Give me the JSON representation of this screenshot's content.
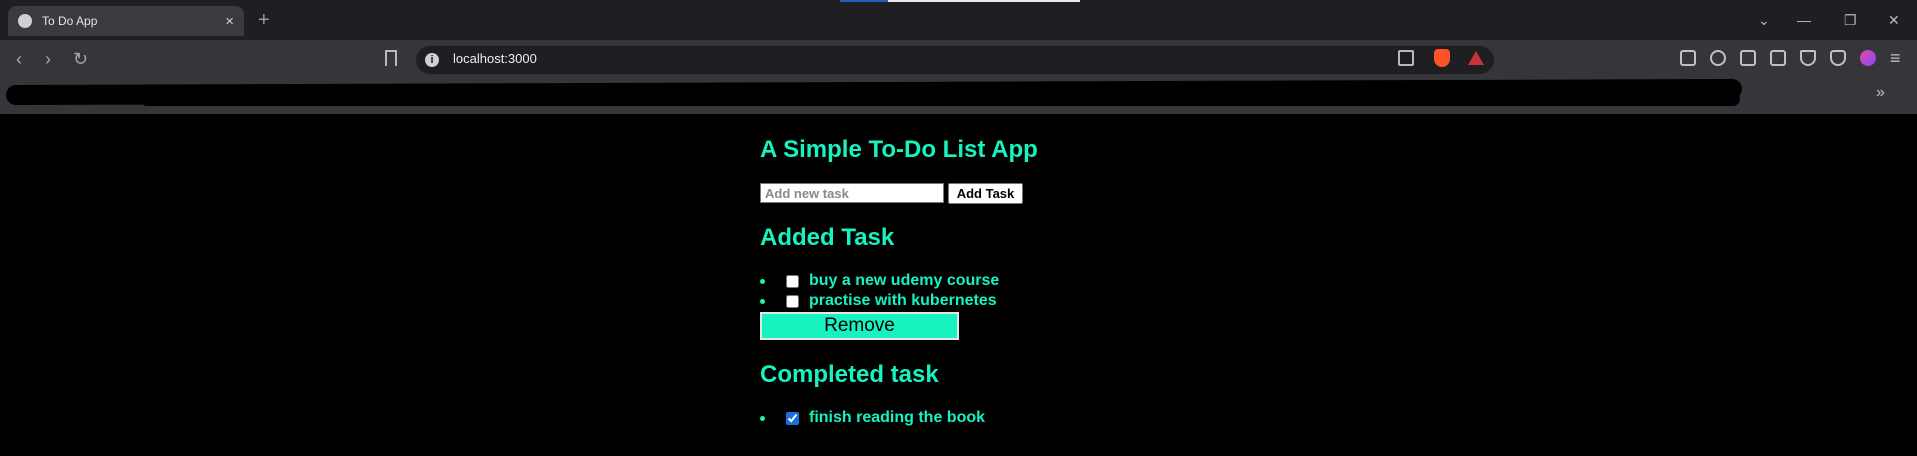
{
  "browser": {
    "tab_title": "To Do App",
    "tab_close": "×",
    "new_tab": "+",
    "url": "localhost:3000",
    "info_glyph": "i",
    "back_glyph": "‹",
    "forward_glyph": "›",
    "reload_glyph": "↻",
    "minimize_glyph": "—",
    "restore_glyph": "❐",
    "close_glyph": "✕",
    "tab_list_glyph": "⌄",
    "menu_glyph": "≡",
    "more_bookmarks_glyph": "»"
  },
  "app": {
    "title": "A Simple To-Do List App",
    "input_placeholder": "Add new task",
    "add_button_label": "Add Task",
    "added_heading": "Added Task",
    "added_tasks": [
      {
        "text": "buy a new udemy course",
        "checked": false
      },
      {
        "text": "practise with kubernetes",
        "checked": false
      }
    ],
    "remove_button_label": "Remove",
    "completed_heading": "Completed task",
    "completed_tasks": [
      {
        "text": "finish reading the book",
        "checked": true
      }
    ]
  },
  "colors": {
    "accent": "#17f2c0",
    "page_background": "#000000"
  },
  "icons": [
    "globe-icon",
    "close-icon",
    "plus-icon",
    "chevron-down-icon",
    "back-icon",
    "forward-icon",
    "reload-icon",
    "bookmark-icon",
    "info-icon",
    "share-icon",
    "brave-shields-icon",
    "brave-rewards-icon",
    "extensions-icon",
    "media-icon",
    "sidebar-icon",
    "wallet-icon",
    "leo-icon",
    "vpn-icon",
    "menu-icon"
  ]
}
